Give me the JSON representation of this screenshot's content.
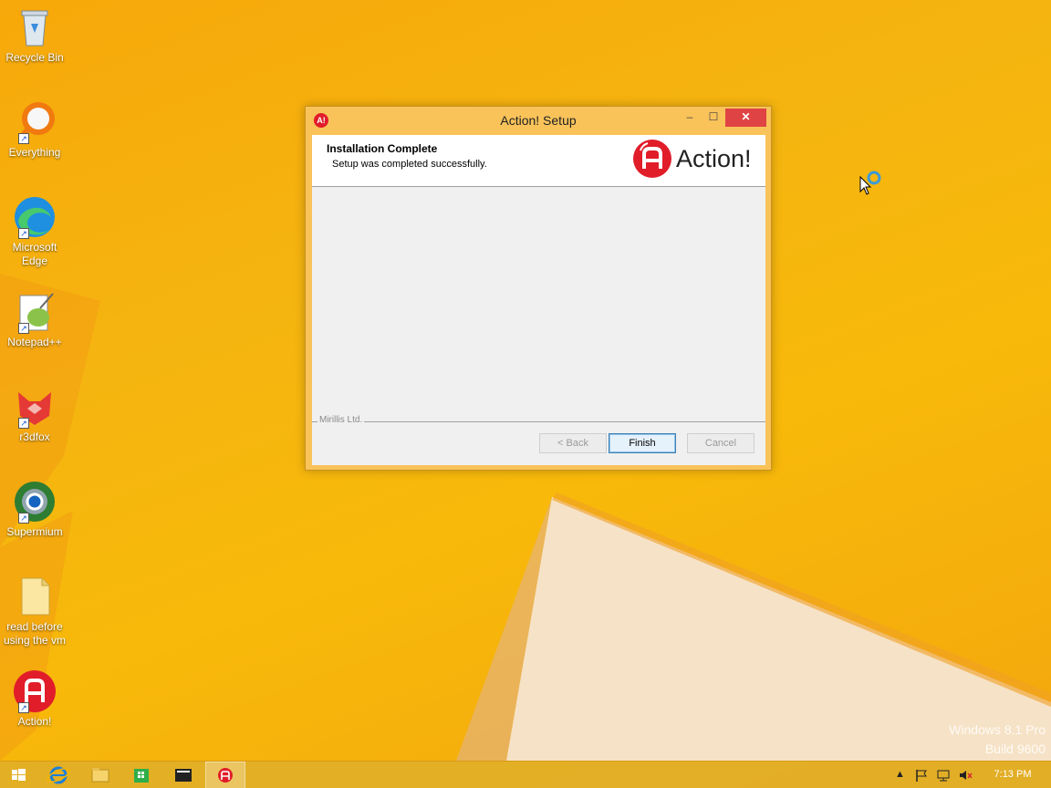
{
  "desktop": {
    "icons": [
      {
        "label": "Recycle Bin"
      },
      {
        "label": "Everything"
      },
      {
        "label": "Microsoft Edge"
      },
      {
        "label": "Notepad++"
      },
      {
        "label": "r3dfox"
      },
      {
        "label": "Supermium"
      },
      {
        "label": "read before using the vm"
      },
      {
        "label": "Action!"
      }
    ],
    "watermark": {
      "line1": "Windows 8.1 Pro",
      "line2": "Build 9600"
    }
  },
  "window": {
    "title": "Action! Setup",
    "icon_text": "A!",
    "header_title": "Installation Complete",
    "header_subtitle": "Setup was completed successfully.",
    "brand_name": "Action!",
    "vendor": "Mirillis Ltd.",
    "buttons": {
      "back": "< Back",
      "finish": "Finish",
      "cancel": "Cancel"
    },
    "controls": {
      "minimize": "–",
      "maximize": "☐",
      "close": "✕"
    }
  },
  "taskbar": {
    "clock": "7:13 PM",
    "items": [
      "start-icon",
      "internet-explorer-icon",
      "file-explorer-icon",
      "store-icon",
      "start-menu-app-icon",
      "action-app-icon"
    ],
    "tray": {
      "show_hidden": "▲"
    }
  },
  "colors": {
    "accent_red": "#e11d2a",
    "wallpaper_orange": "#f5b510",
    "window_border": "#f9c35a"
  }
}
